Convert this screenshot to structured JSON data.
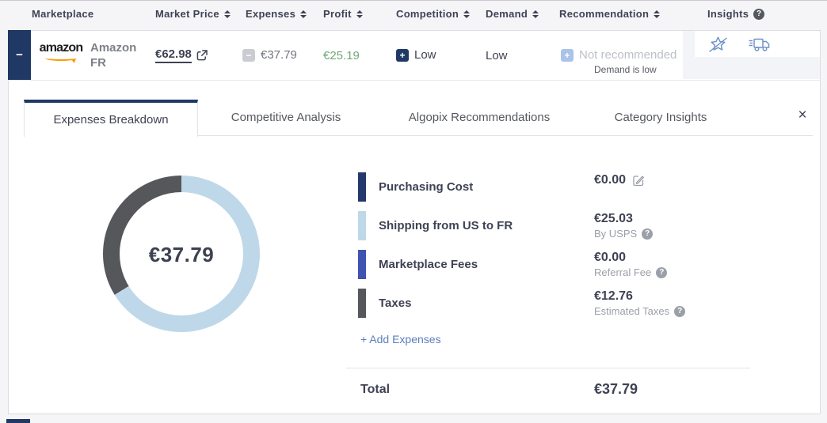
{
  "icons": {
    "help_glyph": "?",
    "minus_glyph": "−",
    "plus_glyph": "+",
    "close_glyph": "×",
    "expander_glyph": "−"
  },
  "header": {
    "columns": [
      {
        "label": "Marketplace"
      },
      {
        "label": "Market Price"
      },
      {
        "label": "Expenses"
      },
      {
        "label": "Profit"
      },
      {
        "label": "Competition"
      },
      {
        "label": "Demand"
      },
      {
        "label": "Recommendation"
      },
      {
        "label": "Insights"
      }
    ]
  },
  "row": {
    "logo": "amazon",
    "marketplace_line1": "Amazon",
    "marketplace_line2": "FR",
    "market_price": "€62.98",
    "expenses": "€37.79",
    "profit": "€25.19",
    "competition": "Low",
    "demand": "Low",
    "recommendation": "Not recommended",
    "recommendation_note": "Demand is low"
  },
  "tabs": {
    "items": [
      {
        "label": "Expenses Breakdown",
        "active": true
      },
      {
        "label": "Competitive Analysis",
        "active": false
      },
      {
        "label": "Algopix Recommendations",
        "active": false
      },
      {
        "label": "Category Insights",
        "active": false
      }
    ]
  },
  "chart_data": {
    "type": "donut",
    "title": "Expenses Breakdown",
    "center_label": "€37.79",
    "total": 37.79,
    "currency": "EUR",
    "segments": [
      {
        "label": "Purchasing Cost",
        "value": 0,
        "color": "#24386b"
      },
      {
        "label": "Shipping from US to FR",
        "value": 25.03,
        "color": "#bed8e9"
      },
      {
        "label": "Marketplace Fees",
        "value": 0,
        "color": "#4053b0"
      },
      {
        "label": "Taxes",
        "value": 12.76,
        "color": "#55575a"
      }
    ]
  },
  "expense_list": {
    "items": [
      {
        "label": "Purchasing Cost",
        "value": "€0.00",
        "note": "",
        "color": "#24386b"
      },
      {
        "label": "Shipping from US to FR",
        "value": "€25.03",
        "note": "By USPS",
        "color": "#bed8e9"
      },
      {
        "label": "Marketplace Fees",
        "value": "€0.00",
        "note": "Referral Fee",
        "color": "#4053b0"
      },
      {
        "label": "Taxes",
        "value": "€12.76",
        "note": "Estimated Taxes",
        "color": "#55575a"
      }
    ],
    "add_expenses_label": "+ Add Expenses",
    "total_label": "Total",
    "total_value": "€37.79"
  }
}
